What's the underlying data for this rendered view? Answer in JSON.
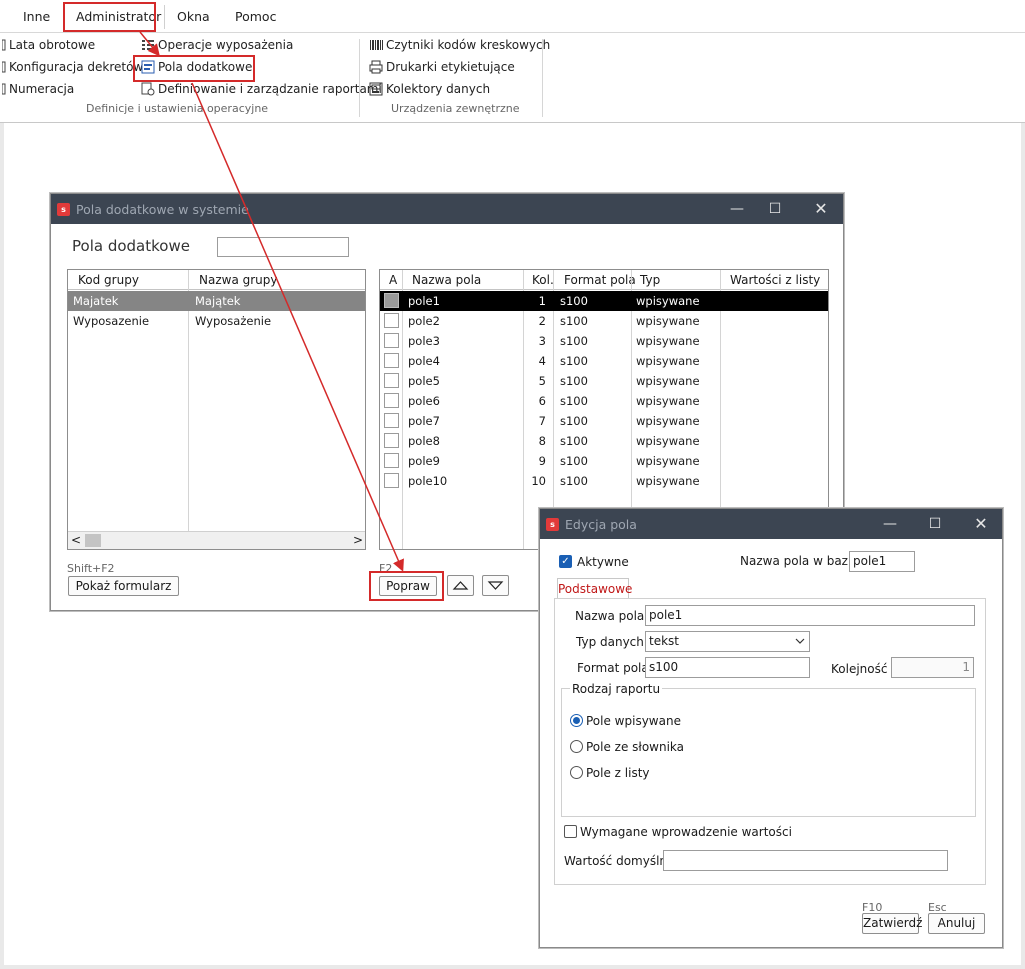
{
  "menu": [
    "Inne",
    "Administrator",
    "Okna",
    "Pomoc"
  ],
  "ribbon": {
    "col1": [
      "Lata obrotowe",
      "Konfiguracja dekretów",
      "Numeracja"
    ],
    "col2": [
      "Operacje wyposażenia",
      "Pola dodatkowe",
      "Definiowanie i zarządzanie raportami"
    ],
    "group1_label": "Definicje i ustawienia operacyjne",
    "col3": [
      "Czytniki kodów kreskowych",
      "Drukarki etykietujące",
      "Kolektory danych"
    ],
    "group2_label": "Urządzenia zewnętrzne"
  },
  "win1": {
    "title": "Pola dodatkowe w  systemie",
    "heading": "Pola dodatkowe",
    "search_value": "",
    "left_headers": [
      "Kod grupy",
      "Nazwa grupy"
    ],
    "left_rows": [
      {
        "kod": "Majatek",
        "nazwa": "Majątek"
      },
      {
        "kod": "Wyposazenie",
        "nazwa": "Wyposażenie"
      }
    ],
    "right_headers": [
      "A",
      "Nazwa pola",
      "Kol.",
      "Format pola",
      "Typ",
      "Wartości z listy"
    ],
    "right_rows": [
      {
        "nazwa": "pole1",
        "kol": "1",
        "format": "s100",
        "typ": "wpisywane"
      },
      {
        "nazwa": "pole2",
        "kol": "2",
        "format": "s100",
        "typ": "wpisywane"
      },
      {
        "nazwa": "pole3",
        "kol": "3",
        "format": "s100",
        "typ": "wpisywane"
      },
      {
        "nazwa": "pole4",
        "kol": "4",
        "format": "s100",
        "typ": "wpisywane"
      },
      {
        "nazwa": "pole5",
        "kol": "5",
        "format": "s100",
        "typ": "wpisywane"
      },
      {
        "nazwa": "pole6",
        "kol": "6",
        "format": "s100",
        "typ": "wpisywane"
      },
      {
        "nazwa": "pole7",
        "kol": "7",
        "format": "s100",
        "typ": "wpisywane"
      },
      {
        "nazwa": "pole8",
        "kol": "8",
        "format": "s100",
        "typ": "wpisywane"
      },
      {
        "nazwa": "pole9",
        "kol": "9",
        "format": "s100",
        "typ": "wpisywane"
      },
      {
        "nazwa": "pole10",
        "kol": "10",
        "format": "s100",
        "typ": "wpisywane"
      }
    ],
    "shortcut_left": "Shift+F2",
    "show_form_label": "Pokaż formularz",
    "shortcut_right": "F2",
    "edit_label": "Popraw"
  },
  "win2": {
    "title": "Edycja pola",
    "active_label": "Aktywne",
    "db_name_label": "Nazwa pola w bazie:",
    "db_name_value": "pole1",
    "tab_label": "Podstawowe",
    "name_label": "Nazwa pola",
    "name_value": "pole1",
    "type_label": "Typ danych",
    "type_value": "tekst",
    "format_label": "Format pola",
    "format_value": "s100",
    "order_label": "Kolejność",
    "order_value": "1",
    "report_group_label": "Rodzaj raportu",
    "radio_options": [
      "Pole wpisywane",
      "Pole ze słownika",
      "Pole z listy"
    ],
    "required_label": "Wymagane wprowadzenie wartości",
    "default_label": "Wartość domyślna",
    "default_value": "",
    "f10_label": "F10",
    "esc_label": "Esc",
    "confirm_label": "Zatwierdź",
    "cancel_label": "Anuluj"
  },
  "colors": {
    "titlebar": "#3c4552",
    "annotation": "#d42a2a",
    "accent": "#1a5fb4"
  }
}
